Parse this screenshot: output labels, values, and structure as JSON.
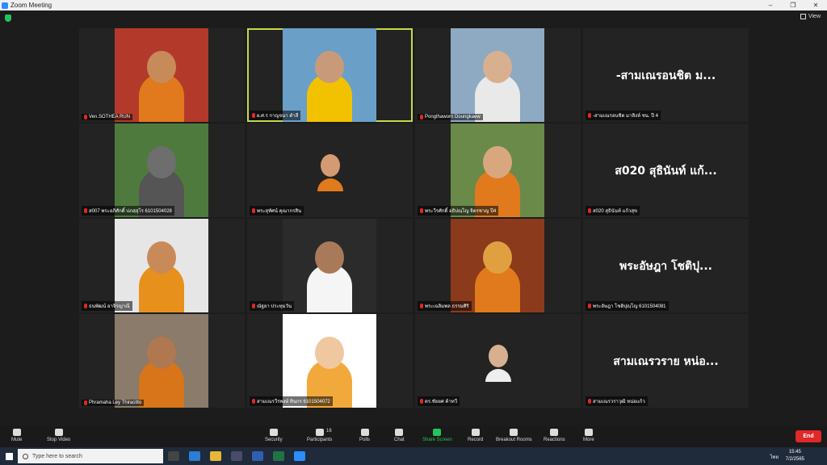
{
  "window": {
    "title": "Zoom Meeting",
    "buttons": [
      "–",
      "❐",
      "✕"
    ]
  },
  "view_label": "View",
  "tiles": [
    {
      "name": "Ven.SOTHEA RUN",
      "big": "",
      "bg": "#b33a2a",
      "skin": "#c98a5a",
      "robe": "#e07a1c"
    },
    {
      "name": "ผ.ศ.ร กาญจนา ดำสี",
      "big": "",
      "bg": "#6aa0c8",
      "skin": "#c99a7a",
      "robe": "#f2c200",
      "active": true
    },
    {
      "name": "Pongthaworn Doungkaew",
      "big": "",
      "bg": "#8ea9c2",
      "skin": "#d8b090",
      "robe": "#e9e9e9"
    },
    {
      "name": "-สามเณรอนชิต มาสิงห์ ชน. ปี 4",
      "big": "-สามเณรอนชิต ม...",
      "bg": "",
      "skin": "",
      "robe": ""
    },
    {
      "name": "ส007 พระอภิศักดิ์ ปภสฺสุโร 6101504028",
      "big": "",
      "bg": "#4f7a3e",
      "skin": "#6e6e6e",
      "robe": "#555"
    },
    {
      "name": "พระสุทัศน์ คุณากรสิน",
      "big": "",
      "bg": "#232323",
      "skin": "#d49a72",
      "robe": "#e07a1c",
      "small": true
    },
    {
      "name": "พระวีรศักดิ์ อธิปญฺโญ จิตรชาญ ปี4",
      "big": "",
      "bg": "#6a8a4a",
      "skin": "#d9a77e",
      "robe": "#e07a1c"
    },
    {
      "name": "ส020 สุธินันท์ แก้วสุข",
      "big": "ส020  สุธินันท์ แก้...",
      "bg": "",
      "skin": "",
      "robe": ""
    },
    {
      "name": "ธนพัฒน์ อาจิรญาณี",
      "big": "",
      "bg": "#e6e6e6",
      "skin": "#c98a5a",
      "robe": "#e8901c"
    },
    {
      "name": "ณัฐยา ประทุมวัน",
      "big": "",
      "bg": "#2b2b2b",
      "skin": "#a87a5a",
      "robe": "#f5f5f5"
    },
    {
      "name": "พระเฉลิมพล ธรรมศิริ",
      "big": "",
      "bg": "#8c3a1c",
      "skin": "#e0a040",
      "robe": "#e07a1c"
    },
    {
      "name": "พระอัษฎา โชติปุญฺโญ 6101504081",
      "big": "พระอัษฎา โชติปุ...",
      "bg": "",
      "skin": "",
      "robe": ""
    },
    {
      "name": "Phramaha Ley Thiracitto",
      "big": "",
      "bg": "#8a7b6a",
      "skin": "#b07850",
      "robe": "#d8741a"
    },
    {
      "name": "สามเณรวีรพงษ์ ทินกร 6101504072",
      "big": "",
      "bg": "#ffffff",
      "skin": "#f0c8a0",
      "robe": "#f2a93b"
    },
    {
      "name": "ดร.ชัยยศ ค้าทวี",
      "big": "",
      "bg": "#232323",
      "skin": "#d8b090",
      "robe": "#eeeeee",
      "small": true
    },
    {
      "name": "สามเณรวราวุฒิ หน่อแก้ว",
      "big": "สามเณรวราย  หน่อ...",
      "bg": "",
      "skin": "",
      "robe": ""
    }
  ],
  "toolbar": {
    "mute": "Mute",
    "stop_video": "Stop Video",
    "security": "Security",
    "participants": "Participants",
    "participants_count": "16",
    "polls": "Polls",
    "chat": "Chat",
    "share_screen": "Share Screen",
    "record": "Record",
    "breakout": "Breakout Rooms",
    "reactions": "Reactions",
    "more": "More",
    "end": "End"
  },
  "taskbar": {
    "search_placeholder": "Type here to search",
    "time": "15:45",
    "date": "7/2/2565",
    "lang": "ไทย"
  },
  "colors": {
    "active_border": "#c7d64e",
    "end_red": "#e02828",
    "share_green": "#23c45e"
  }
}
